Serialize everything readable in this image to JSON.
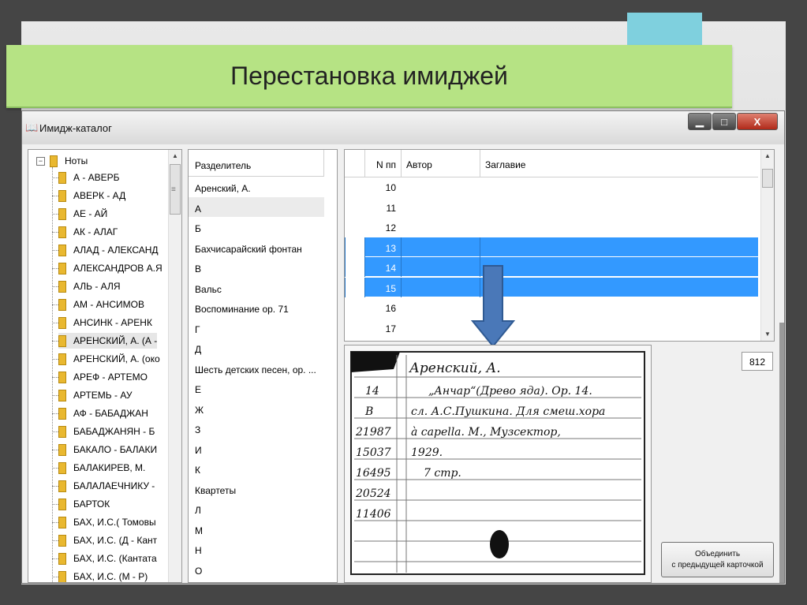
{
  "slide": {
    "title": "Перестановка имиджей"
  },
  "window": {
    "title": "Имидж-каталог",
    "controls": {
      "minimize": "▁",
      "maximize": "□",
      "close": "X"
    }
  },
  "tree": {
    "root_label": "Ноты",
    "root_toggle": "−",
    "items": [
      "А - АВЕРБ",
      "АВЕРК - АД",
      "АЕ - АЙ",
      "АК - АЛАГ",
      "АЛАД - АЛЕКСАНД",
      "АЛЕКСАНДРОВ А.Я",
      "АЛЬ - АЛЯ",
      "АМ - АНСИМОВ",
      "АНСИНК - АРЕНК",
      "АРЕНСКИЙ, А. (А -",
      "АРЕНСКИЙ, А. (око",
      "АРЕФ - АРТЕМО",
      "АРТЕМЬ - АУ",
      "АФ - БАБАДЖАН",
      "БАБАДЖАНЯН - Б",
      "БАКАЛО - БАЛАКИ",
      "БАЛАКИРЕВ, М.",
      "БАЛАЛАЕЧНИКУ -",
      "БАРТОК",
      "БАХ, И.С.( Томовы",
      "БАХ, И.С. (Д - Кант",
      "БАХ, И.С. (Кантата",
      "БАХ, И.С. (М - Р)"
    ],
    "selected_index": 9
  },
  "separators": {
    "header": "Разделитель",
    "items": [
      "Аренский, А.",
      "А",
      "Б",
      "Бахчисарайский фонтан",
      "В",
      "Вальс",
      "Воспоминание ор. 71",
      "Г",
      "Д",
      "Шесть детских песен, ор. ...",
      "Е",
      "Ж",
      "З",
      "И",
      "К",
      "Квартеты",
      "Л",
      "М",
      "Н",
      "О"
    ],
    "selected_index": 1
  },
  "grid": {
    "columns": {
      "n": "N пп",
      "author": "Автор",
      "title": "Заглавие"
    },
    "rows": [
      {
        "n": "10",
        "author": "",
        "title": "",
        "selected": false,
        "mark": ""
      },
      {
        "n": "11",
        "author": "",
        "title": "",
        "selected": false,
        "mark": ""
      },
      {
        "n": "12",
        "author": "",
        "title": "",
        "selected": false,
        "mark": ""
      },
      {
        "n": "13",
        "author": "",
        "title": "",
        "selected": true,
        "mark": "✂"
      },
      {
        "n": "14",
        "author": "",
        "title": "",
        "selected": true,
        "mark": "✂"
      },
      {
        "n": "15",
        "author": "",
        "title": "",
        "selected": true,
        "mark": "✂"
      },
      {
        "n": "16",
        "author": "",
        "title": "",
        "selected": false,
        "mark": ""
      },
      {
        "n": "17",
        "author": "",
        "title": "",
        "selected": false,
        "mark": ""
      }
    ]
  },
  "card": {
    "count": "812",
    "lines": [
      "Аренский, А.",
      "14",
      "„Анчар“(Древо яда). Ор. 14.",
      "В",
      "сл. А.С.Пушкина. Для смеш.хора",
      "21987",
      "à capella.        М., Музсектор,",
      "15037",
      "1929.",
      "16495",
      "7 стр.",
      "20524",
      "11406"
    ]
  },
  "merge_button": {
    "line1": "Объединить",
    "line2": "с предыдущей карточкой"
  },
  "colors": {
    "selection": "#3399ff",
    "banner": "#b6e384",
    "arrow": "#4a78b8"
  }
}
